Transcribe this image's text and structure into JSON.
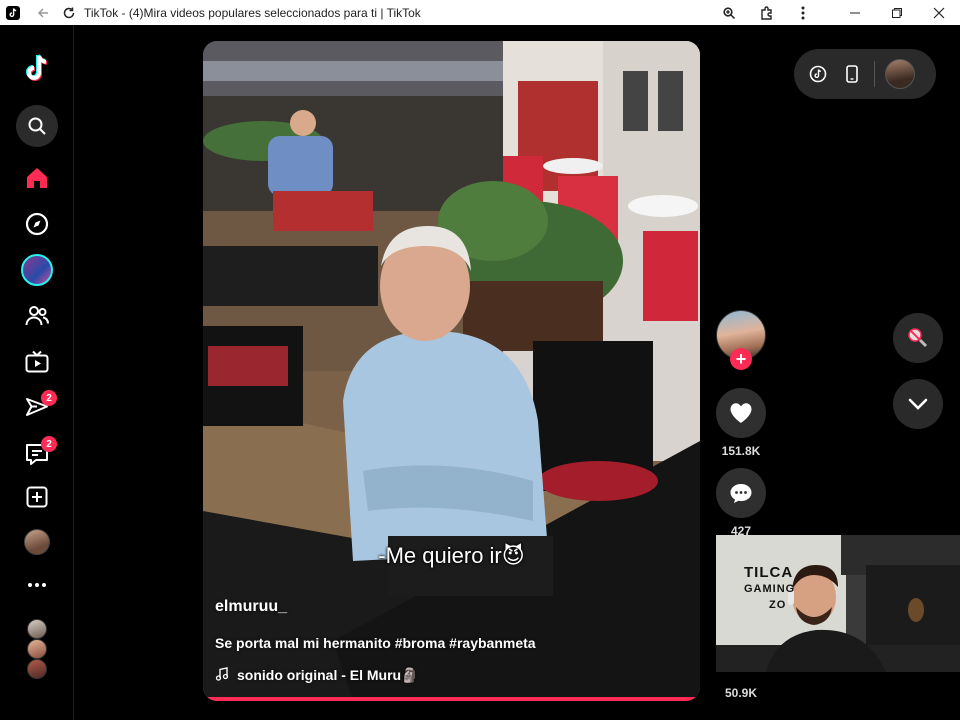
{
  "browser": {
    "tab_title": "TikTok - (4)Mira videos populares seleccionados para ti | TikTok",
    "icons": [
      "back-arrow-icon",
      "reload-icon",
      "zoom-icon",
      "extensions-icon",
      "more-vertical-icon",
      "minimize-icon",
      "restore-icon",
      "close-icon"
    ]
  },
  "sidebar": {
    "items": [
      {
        "name": "tiktok-logo",
        "icon": "tiktok-logo-icon"
      },
      {
        "name": "search",
        "icon": "search-icon"
      },
      {
        "name": "home",
        "icon": "home-icon",
        "active": true
      },
      {
        "name": "explore",
        "icon": "compass-icon"
      },
      {
        "name": "live-avatar",
        "icon": "avatar"
      },
      {
        "name": "following",
        "icon": "people-icon"
      },
      {
        "name": "live",
        "icon": "tv-icon"
      },
      {
        "name": "messages",
        "icon": "send-icon",
        "badge": "2"
      },
      {
        "name": "activity",
        "icon": "inbox-icon",
        "badge": "2"
      },
      {
        "name": "upload",
        "icon": "plus-square-icon"
      },
      {
        "name": "profile",
        "icon": "avatar"
      },
      {
        "name": "more",
        "icon": "more-horizontal-icon"
      }
    ]
  },
  "video": {
    "caption_text": "-Me quiero ir😈",
    "username": "elmuruu_",
    "description": "Se porta mal mi hermanito #broma #raybanmeta",
    "sound": "sonido original - El Muru🗿",
    "progress": 1.0
  },
  "actions": {
    "likes": "151.8K",
    "comments": "427",
    "shares": "50.9K"
  },
  "webcam": {
    "sign_line1": "TILCA",
    "sign_line2": "GAMING",
    "sign_line3": "ZO"
  },
  "colors": {
    "accent": "#fe2c55",
    "live_ring": "#25f4ee",
    "background": "#000000",
    "button_bg": "#2f2f2f"
  }
}
